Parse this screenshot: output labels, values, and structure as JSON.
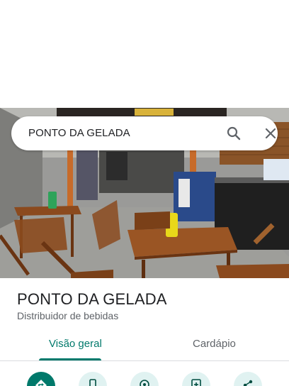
{
  "search": {
    "value": "PONTO DA GELADA"
  },
  "place": {
    "name": "PONTO DA GELADA",
    "category": "Distribuidor de bebidas"
  },
  "tabs": [
    {
      "label": "Visão geral",
      "active": true
    },
    {
      "label": "Cardápio",
      "active": false
    }
  ],
  "actions": [
    {
      "icon": "directions-icon"
    },
    {
      "icon": "phone-icon"
    },
    {
      "icon": "location-icon"
    },
    {
      "icon": "save-icon"
    },
    {
      "icon": "share-icon"
    }
  ],
  "colors": {
    "accent": "#00796b",
    "accent_light": "#e0f2f1"
  }
}
